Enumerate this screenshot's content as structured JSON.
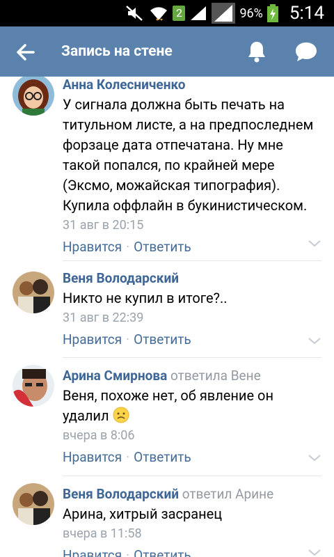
{
  "status_bar": {
    "sim_label": "2",
    "battery_percent": "96%",
    "time": "5:14",
    "icons": [
      "mute-icon",
      "wifi-icon",
      "sim-2-icon",
      "signal-icon",
      "signal-icon",
      "battery-charging-icon"
    ]
  },
  "app_bar": {
    "title": "Запись на стене",
    "icons": [
      "back-arrow-icon",
      "bell-icon",
      "chat-icon"
    ],
    "color": "#5b82ad"
  },
  "comments": [
    {
      "author": "Анна Колесниченко",
      "reply_to": "",
      "text": "У сигнала должна быть печать на титульном листе, а на предпоследнем форзаце дата отпечатана. Ну мне такой попался, по крайней мере (Эксмо, можайская типография). Купила оффлайн в букинистическом.",
      "time": "31 авг в 20:15",
      "like_label": "Нравится",
      "reply_label": "Ответить"
    },
    {
      "author": "Веня Володарский",
      "reply_to": "",
      "text": "Никто не купил в итоге?..",
      "time": "31 авг в 22:39",
      "like_label": "Нравится",
      "reply_label": "Ответить"
    },
    {
      "author": "Арина Смирнова",
      "reply_to": "ответила Вене",
      "text": "Веня, похоже нет, об явление он удалил",
      "time": "вчера в 8:06",
      "like_label": "Нравится",
      "reply_label": "Ответить",
      "emoji": "sad-face-emoji"
    },
    {
      "author": "Веня Володарский",
      "reply_to": "ответил Арине",
      "text": "Арина, хитрый засранец",
      "time": "вчера в 11:58",
      "like_label": "Нравится",
      "reply_label": "Ответить"
    }
  ],
  "separator": "·"
}
